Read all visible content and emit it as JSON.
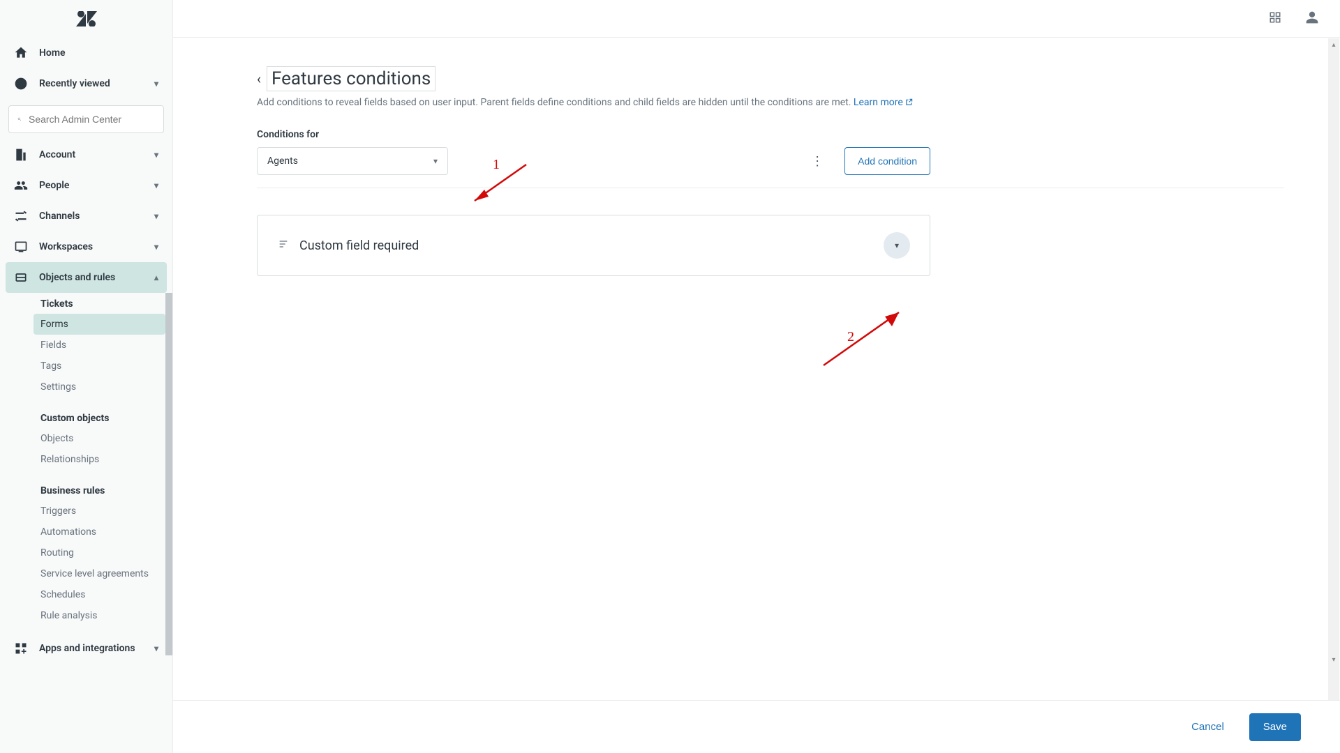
{
  "topbar": {},
  "sidebar": {
    "search_placeholder": "Search Admin Center",
    "items": {
      "home": "Home",
      "recent": "Recently viewed",
      "account": "Account",
      "people": "People",
      "channels": "Channels",
      "workspaces": "Workspaces",
      "objects": "Objects and rules",
      "apps": "Apps and integrations"
    },
    "sub": {
      "tickets_title": "Tickets",
      "forms": "Forms",
      "fields": "Fields",
      "tags": "Tags",
      "settings": "Settings",
      "custom_title": "Custom objects",
      "objects": "Objects",
      "relationships": "Relationships",
      "rules_title": "Business rules",
      "triggers": "Triggers",
      "automations": "Automations",
      "routing": "Routing",
      "sla": "Service level agreements",
      "schedules": "Schedules",
      "rule_analysis": "Rule analysis"
    }
  },
  "page": {
    "title": "Features conditions",
    "desc": "Add conditions to reveal fields based on user input. Parent fields define conditions and child fields are hidden until the conditions are met. ",
    "learn_more": "Learn more",
    "conditions_label": "Conditions for",
    "conditions_value": "Agents",
    "add_condition": "Add condition",
    "card_title": "Custom field required"
  },
  "footer": {
    "cancel": "Cancel",
    "save": "Save"
  },
  "annotations": {
    "one": "1",
    "two": "2"
  }
}
